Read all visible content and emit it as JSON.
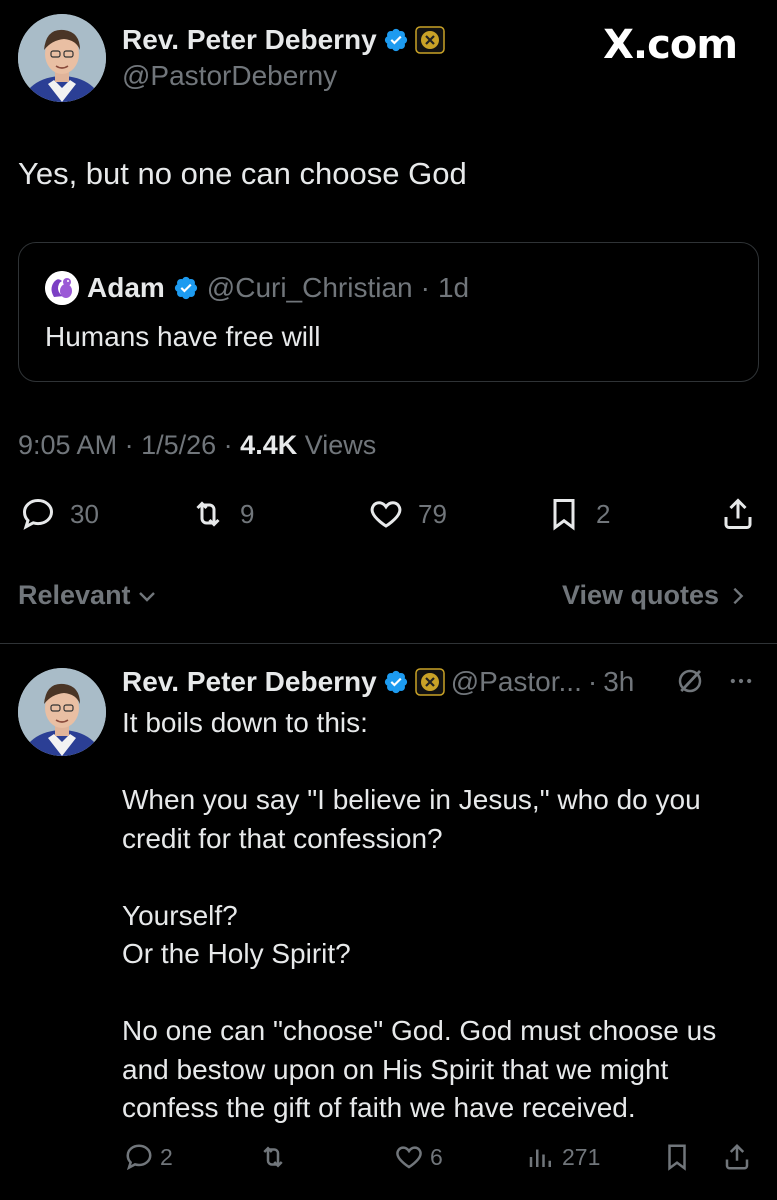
{
  "header": {
    "author_name": "Rev. Peter Deberny",
    "author_handle": "@PastorDeberny",
    "brand": "X.com"
  },
  "tweet": {
    "text": "Yes, but no one can choose God",
    "quote": {
      "name": "Adam",
      "handle": "@Curi_Christian",
      "time": "1d",
      "text": "Humans have free will"
    },
    "meta": {
      "time": "9:05 AM",
      "date": "1/5/26",
      "views_count": "4.4K",
      "views_label": "Views"
    },
    "actions": {
      "replies": "30",
      "reposts": "9",
      "likes": "79",
      "bookmarks": "2"
    }
  },
  "sort": {
    "relevant_label": "Relevant",
    "view_quotes_label": "View quotes"
  },
  "reply": {
    "name": "Rev. Peter Deberny",
    "handle": "@Pastor...",
    "time": "3h",
    "lines": [
      "It boils down to this:",
      "",
      "When you say \"I believe in Jesus,\" who do you",
      "credit for that confession?",
      "",
      "Yourself?",
      "Or the Holy Spirit?",
      "",
      "No one can \"choose\" God. God must choose us",
      "and bestow upon on His Spirit that we might",
      "confess the gift of faith we have received."
    ],
    "actions": {
      "replies": "2",
      "likes": "6",
      "views": "271"
    }
  },
  "colors": {
    "background": "#000000",
    "text": "#e7e9ea",
    "muted": "#71767b",
    "verified": "#1d9bf0",
    "border": "#2f3336",
    "gold": "#c9a227"
  },
  "icons": [
    "verified-badge-icon",
    "affiliate-badge-icon",
    "reply-icon",
    "repost-icon",
    "like-icon",
    "bookmark-icon",
    "share-icon",
    "chevron-down-icon",
    "chevron-right-icon",
    "grok-icon",
    "more-icon",
    "views-icon"
  ]
}
